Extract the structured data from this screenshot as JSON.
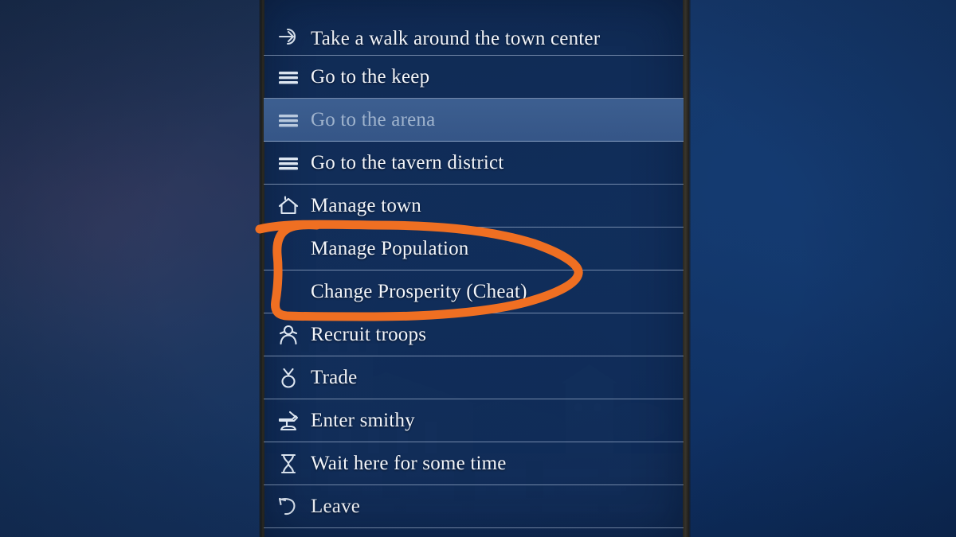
{
  "scene": {
    "background_description": "blurred night-time castle town scene in blue tones",
    "panel_background_color": "#0f2a54",
    "highlight_color": "#3f6294",
    "separator_color": "#c4d6ee",
    "text_color": "#f3f6fb",
    "disabled_text_color": "#9fb3cd",
    "annotation_color": "#ef6f22"
  },
  "menu": {
    "items": [
      {
        "id": "take-a-walk-around-the-town-center",
        "label": "Take a walk around the town center",
        "icon": "enter-arrow-icon",
        "indent": false,
        "state": "normal"
      },
      {
        "id": "go-to-the-keep",
        "label": "Go to the keep",
        "icon": "list-lines-icon",
        "indent": false,
        "state": "normal"
      },
      {
        "id": "go-to-the-arena",
        "label": "Go to the arena",
        "icon": "list-lines-icon",
        "indent": false,
        "state": "highlighted"
      },
      {
        "id": "go-to-the-tavern-district",
        "label": "Go to the tavern district",
        "icon": "list-lines-icon",
        "indent": false,
        "state": "normal"
      },
      {
        "id": "manage-town",
        "label": "Manage town",
        "icon": "house-icon",
        "indent": false,
        "state": "normal"
      },
      {
        "id": "manage-population",
        "label": "Manage Population",
        "icon": "none",
        "indent": true,
        "state": "normal"
      },
      {
        "id": "change-prosperity-cheat",
        "label": "Change Prosperity (Cheat)",
        "icon": "none",
        "indent": true,
        "state": "normal"
      },
      {
        "id": "recruit-troops",
        "label": "Recruit troops",
        "icon": "person-icon",
        "indent": false,
        "state": "normal"
      },
      {
        "id": "trade",
        "label": "Trade",
        "icon": "coin-purse-icon",
        "indent": false,
        "state": "normal"
      },
      {
        "id": "enter-smithy",
        "label": "Enter smithy",
        "icon": "anvil-hammer-icon",
        "indent": false,
        "state": "normal"
      },
      {
        "id": "wait-here-for-some-time",
        "label": "Wait here for some time",
        "icon": "hourglass-icon",
        "indent": false,
        "state": "normal"
      },
      {
        "id": "leave",
        "label": "Leave",
        "icon": "back-arrow-icon",
        "indent": false,
        "state": "normal"
      }
    ]
  },
  "annotation": {
    "shape": "hand-drawn-oval",
    "encircles": [
      "Manage Population",
      "Change Prosperity (Cheat)"
    ],
    "color": "#ef6f22"
  }
}
